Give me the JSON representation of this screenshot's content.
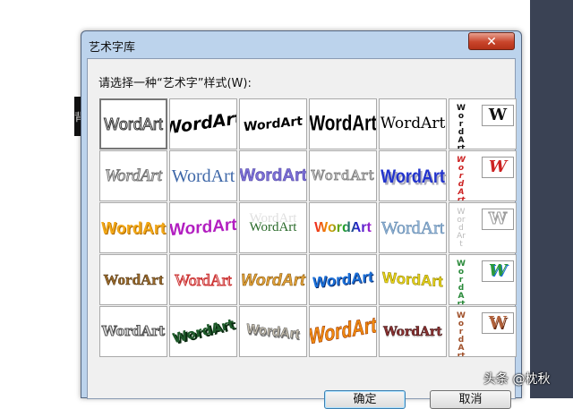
{
  "dialog": {
    "title": "艺术字库",
    "close_glyph": "✕",
    "prompt": "请选择一种“艺术字”样式(W):",
    "ok_label": "确定",
    "cancel_label": "取消"
  },
  "background": {
    "left_sliver_text": "背"
  },
  "watermark": "头条 @枕秋",
  "gallery": {
    "rows": [
      [
        "WordArt",
        "WordArt",
        "WordArt",
        "WordArt",
        "WordArt",
        "WordArt"
      ],
      [
        "WordArt",
        "WordArt",
        "WordArt",
        "WordArt",
        "WordArt",
        "WordArt"
      ],
      [
        "WordArt",
        "WordArt",
        "WordArt",
        "WordArt",
        "WordArt",
        "WordArt"
      ],
      [
        "WordArt",
        "WordArt",
        "WordArt",
        "WordArt",
        "WordArt",
        "WordArt"
      ],
      [
        "WordArt",
        "WordArt",
        "WordArt",
        "WordArt",
        "WordArt",
        "WordArt"
      ]
    ],
    "vertical_preview_glyph": "W",
    "selected": "row 1, column 1"
  },
  "colors": {
    "dialog_frame": "#bcd3ec",
    "close_button": "#c9452b",
    "client_bg": "#f0f0f0",
    "right_panel": "#3a4254"
  }
}
